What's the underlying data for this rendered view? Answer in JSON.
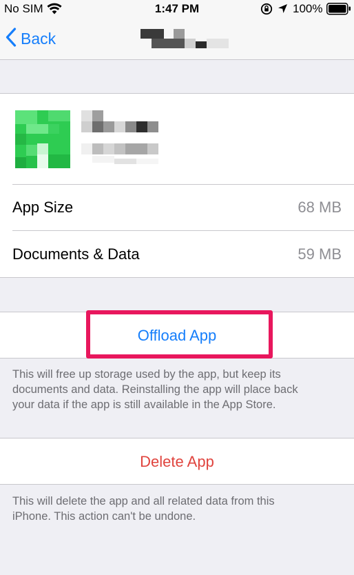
{
  "status_bar": {
    "carrier": "No SIM",
    "time": "1:47 PM",
    "battery_percent": "100%"
  },
  "nav": {
    "back_label": "Back"
  },
  "app_info": {
    "rows": [
      {
        "label": "App Size",
        "value": "68 MB"
      },
      {
        "label": "Documents & Data",
        "value": "59 MB"
      }
    ]
  },
  "offload": {
    "button_label": "Offload App",
    "footer": "This will free up storage used by the app, but keep its documents and data. Reinstalling the app will place back your data if the app is still available in the App Store.",
    "footer_lines": [
      "This will free up storage used by the app, but keep its",
      "documents and data. Reinstalling the app will place back",
      "your data if the app is still available in the App Store."
    ]
  },
  "delete": {
    "button_label": "Delete App",
    "footer_lines": [
      "This will delete the app and all related data from this",
      "iPhone. This action can't be undone."
    ]
  },
  "colors": {
    "ios_blue": "#157efb",
    "destructive_red": "#e0443e",
    "highlight": "#e8175d",
    "app_icon_green": "#2ecc52"
  }
}
